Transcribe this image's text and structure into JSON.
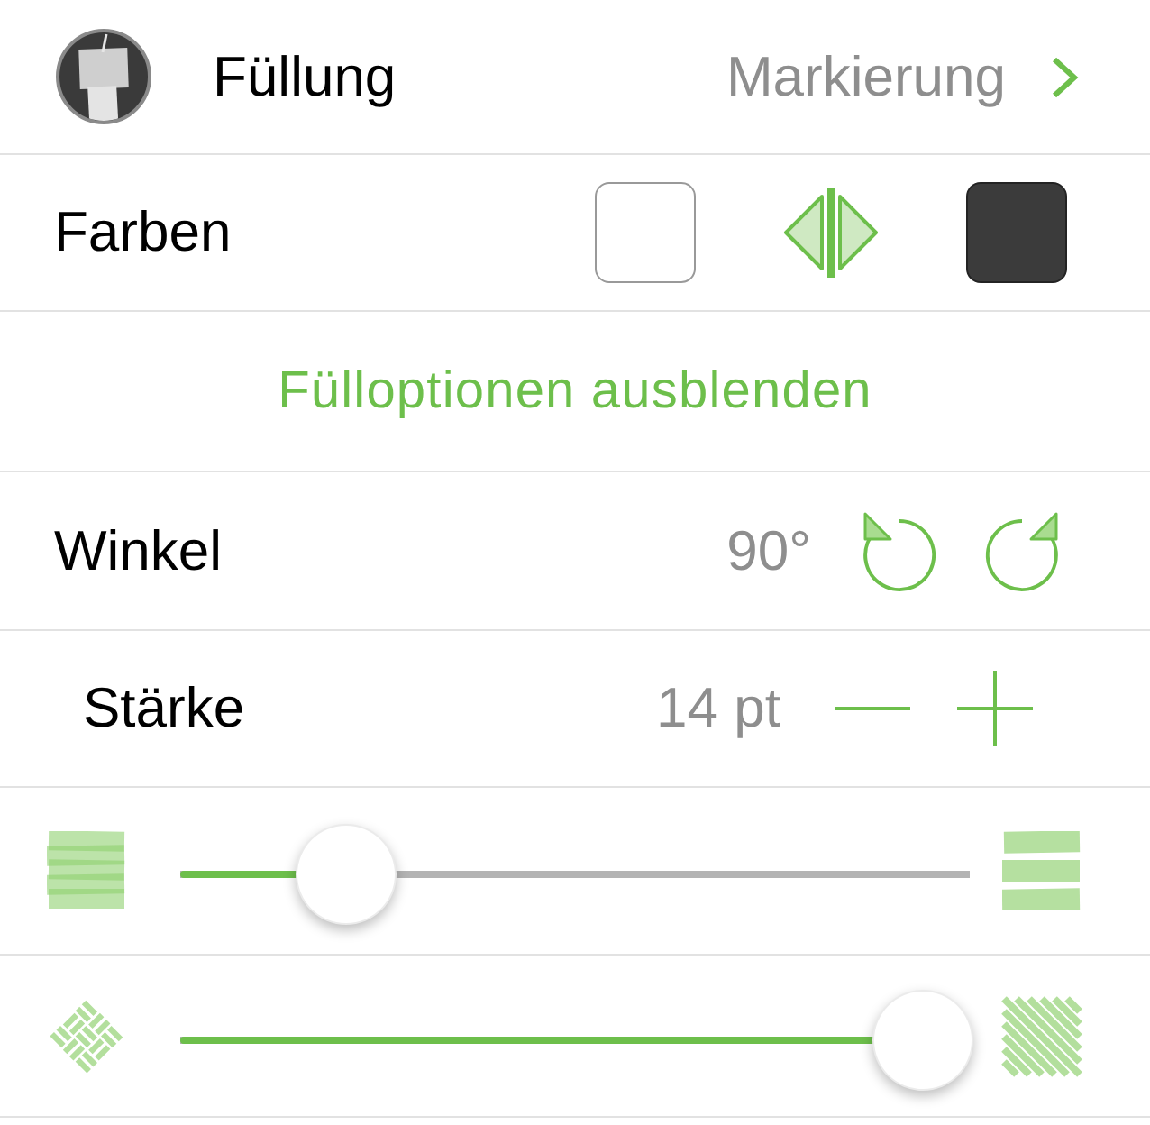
{
  "fill_row": {
    "label": "Füllung",
    "value": "Markierung"
  },
  "colors_row": {
    "label": "Farben",
    "swatches": [
      {
        "color": "#ffffff"
      },
      {
        "color": "#3b3b3b"
      }
    ]
  },
  "toggle_link": {
    "label": "Fülloptionen ausblenden"
  },
  "angle_row": {
    "label": "Winkel",
    "value": "90°"
  },
  "weight_row": {
    "label": "Stärke",
    "value": "14 pt"
  },
  "sliders": [
    {
      "kind": "lines",
      "level": 0.21
    },
    {
      "kind": "hatch",
      "level": 0.94
    }
  ]
}
